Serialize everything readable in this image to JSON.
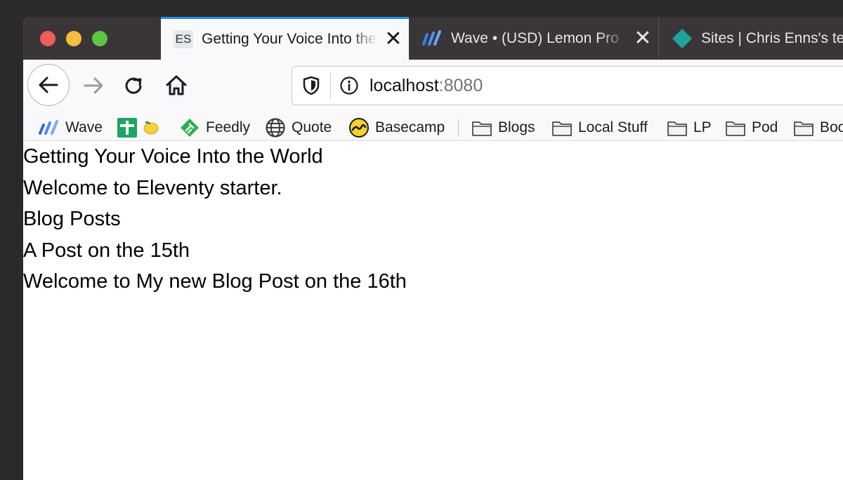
{
  "tabs": [
    {
      "icon": "es-favicon",
      "favicon_text": "ES",
      "title": "Getting Your Voice Into the World",
      "active": true
    },
    {
      "icon": "wave-favicon",
      "title": "Wave • (USD) Lemon Pro",
      "active": false
    },
    {
      "icon": "netlify-favicon",
      "title": "Sites | Chris Enns's te",
      "active": false
    }
  ],
  "navigation": {
    "back_icon": "back-arrow-icon",
    "forward_icon": "forward-arrow-icon",
    "reload_icon": "reload-icon",
    "home_icon": "home-icon"
  },
  "urlbar": {
    "host": "localhost",
    "port": ":8080"
  },
  "bookmarks": [
    {
      "label": "Wave",
      "icon": "wave-icon"
    },
    {
      "label": "",
      "icon": "sheets-plus-icon"
    },
    {
      "label": "",
      "icon": "lemon-icon"
    },
    {
      "label": "Feedly",
      "icon": "feedly-icon"
    },
    {
      "label": "Quote",
      "icon": "globe-icon"
    },
    {
      "label": "Basecamp",
      "icon": "basecamp-icon"
    },
    {
      "label": "Blogs",
      "icon": "folder-icon"
    },
    {
      "label": "Local Stuff",
      "icon": "folder-icon"
    },
    {
      "label": "LP",
      "icon": "folder-icon"
    },
    {
      "label": "Pod",
      "icon": "folder-icon"
    },
    {
      "label": "Boo",
      "icon": "folder-icon"
    }
  ],
  "page": {
    "title": "Getting Your Voice Into the World",
    "welcome": "Welcome to Eleventy starter.",
    "section_heading": "Blog Posts",
    "posts": [
      "A Post on the 15th",
      "Welcome to My new Blog Post on the 16th"
    ]
  },
  "colors": {
    "tabbar_bg": "#3a3638",
    "active_tab_accent": "#1f8cf0",
    "toolbar_bg": "#f9f9fb",
    "desktop_bg": "#2b2a2b"
  }
}
